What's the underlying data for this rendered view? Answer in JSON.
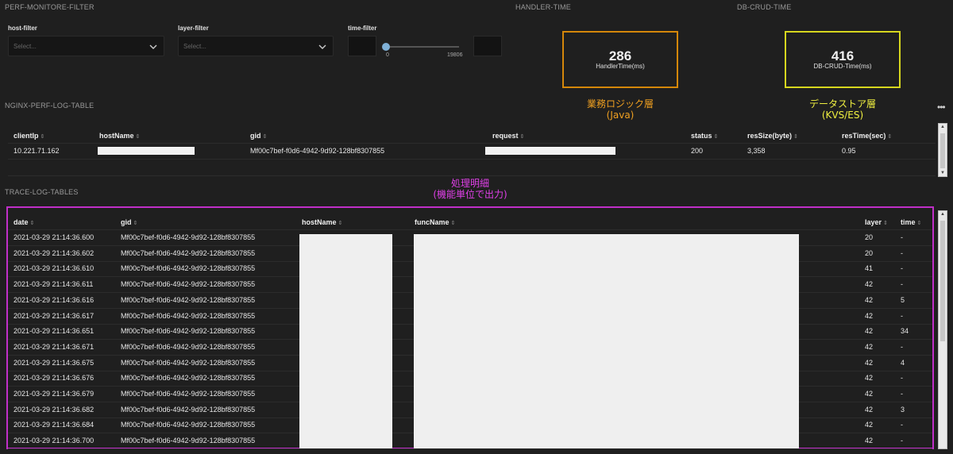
{
  "panels": {
    "filter_title": "PERF-MONITORE-FILTER",
    "handler_title": "HANDLER-TIME",
    "db_title": "DB-CRUD-TIME",
    "nginx_title": "NGINX-PERF-LOG-TABLE",
    "trace_title": "TRACE-LOG-TABLES"
  },
  "filters": {
    "host_label": "host-filter",
    "host_placeholder": "Select...",
    "layer_label": "layer-filter",
    "layer_placeholder": "Select...",
    "time_label": "time-filter",
    "time_min": "0",
    "time_max": "19806"
  },
  "stats": {
    "handler": {
      "value": "286",
      "label": "HandlerTime(ms)",
      "color": "#d4870a"
    },
    "db": {
      "value": "416",
      "label": "DB-CRUD-Time(ms)",
      "color": "#d6d61e"
    }
  },
  "annotations": {
    "handler_line1": "業務ロジック層",
    "handler_line2": "(Java)",
    "handler_color": "#f0a020",
    "db_line1": "データストア層",
    "db_line2": "(KVS/ES)",
    "db_color": "#f0f040",
    "trace_line1": "処理明細",
    "trace_line2": "(機能単位で出力)",
    "trace_color": "#e040e8"
  },
  "nginx_table": {
    "headers": {
      "clientIp": "clientIp",
      "hostName": "hostName",
      "gid": "gid",
      "request": "request",
      "status": "status",
      "resSize": "resSize(byte)",
      "resTime": "resTime(sec)"
    },
    "row": {
      "clientIp": "10.221.71.162",
      "gid": "Mf00c7bef-f0d6-4942-9d92-128bf8307855",
      "status": "200",
      "resSize": "3,358",
      "resTime": "0.95"
    }
  },
  "trace_table": {
    "headers": {
      "date": "date",
      "gid": "gid",
      "hostName": "hostName",
      "funcName": "funcName",
      "layer": "layer",
      "time": "time"
    },
    "rows": [
      {
        "date": "2021-03-29 21:14:36.600",
        "gid": "Mf00c7bef-f0d6-4942-9d92-128bf8307855",
        "layer": "20",
        "time": "-"
      },
      {
        "date": "2021-03-29 21:14:36.602",
        "gid": "Mf00c7bef-f0d6-4942-9d92-128bf8307855",
        "layer": "20",
        "time": "-"
      },
      {
        "date": "2021-03-29 21:14:36.610",
        "gid": "Mf00c7bef-f0d6-4942-9d92-128bf8307855",
        "layer": "41",
        "time": "-"
      },
      {
        "date": "2021-03-29 21:14:36.611",
        "gid": "Mf00c7bef-f0d6-4942-9d92-128bf8307855",
        "layer": "42",
        "time": "-"
      },
      {
        "date": "2021-03-29 21:14:36.616",
        "gid": "Mf00c7bef-f0d6-4942-9d92-128bf8307855",
        "layer": "42",
        "time": "5"
      },
      {
        "date": "2021-03-29 21:14:36.617",
        "gid": "Mf00c7bef-f0d6-4942-9d92-128bf8307855",
        "layer": "42",
        "time": "-"
      },
      {
        "date": "2021-03-29 21:14:36.651",
        "gid": "Mf00c7bef-f0d6-4942-9d92-128bf8307855",
        "layer": "42",
        "time": "34"
      },
      {
        "date": "2021-03-29 21:14:36.671",
        "gid": "Mf00c7bef-f0d6-4942-9d92-128bf8307855",
        "layer": "42",
        "time": "-"
      },
      {
        "date": "2021-03-29 21:14:36.675",
        "gid": "Mf00c7bef-f0d6-4942-9d92-128bf8307855",
        "layer": "42",
        "time": "4"
      },
      {
        "date": "2021-03-29 21:14:36.676",
        "gid": "Mf00c7bef-f0d6-4942-9d92-128bf8307855",
        "layer": "42",
        "time": "-"
      },
      {
        "date": "2021-03-29 21:14:36.679",
        "gid": "Mf00c7bef-f0d6-4942-9d92-128bf8307855",
        "layer": "42",
        "time": "-"
      },
      {
        "date": "2021-03-29 21:14:36.682",
        "gid": "Mf00c7bef-f0d6-4942-9d92-128bf8307855",
        "layer": "42",
        "time": "3"
      },
      {
        "date": "2021-03-29 21:14:36.684",
        "gid": "Mf00c7bef-f0d6-4942-9d92-128bf8307855",
        "layer": "42",
        "time": "-"
      },
      {
        "date": "2021-03-29 21:14:36.700",
        "gid": "Mf00c7bef-f0d6-4942-9d92-128bf8307855",
        "layer": "42",
        "time": "-"
      }
    ]
  },
  "icons": {
    "sort": "sort-icon",
    "chevron": "chevron-down-icon",
    "menu": "more-menu-icon"
  },
  "menu_glyph": "•••",
  "sort_glyph": "⇕"
}
